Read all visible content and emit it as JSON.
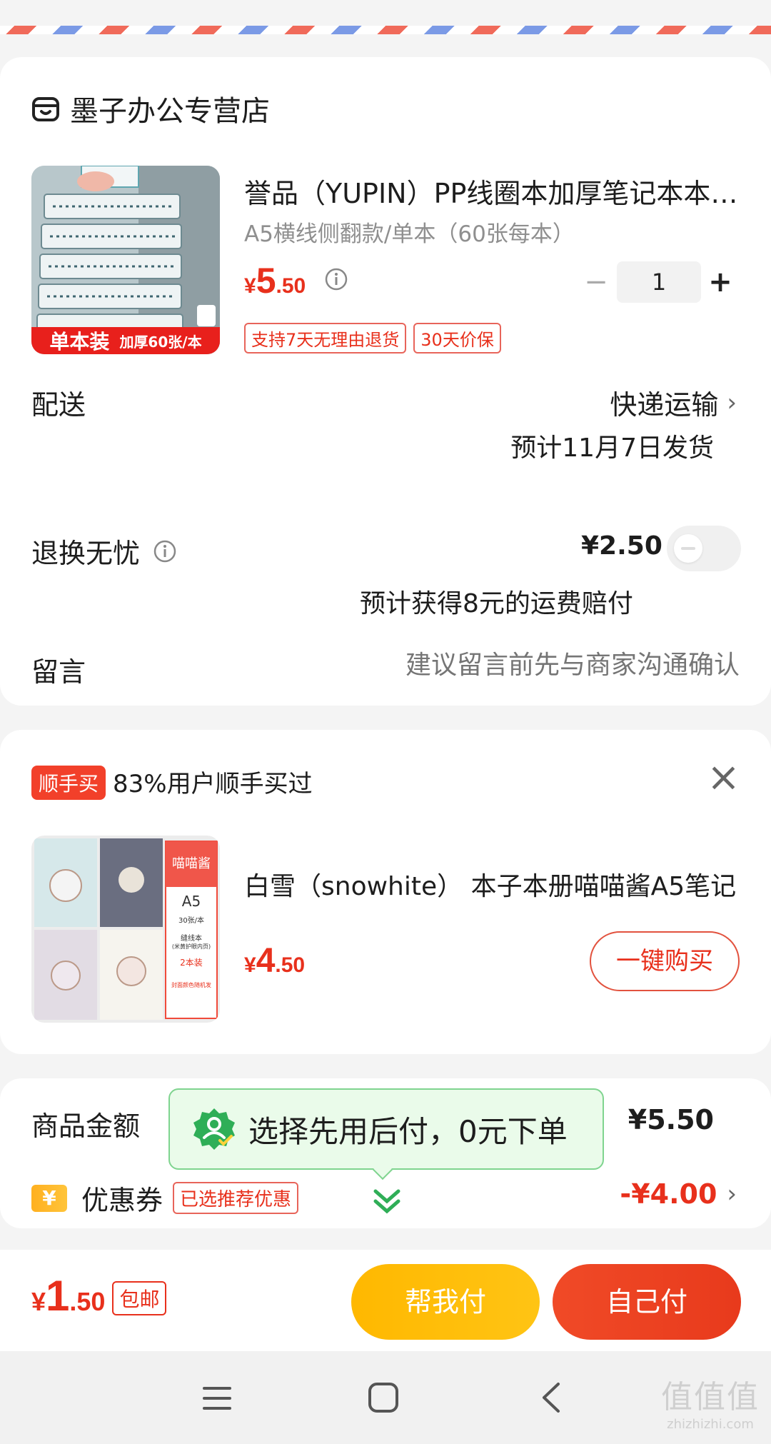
{
  "shop": {
    "name": "墨子办公专营店",
    "icon": "store-icon"
  },
  "product": {
    "title": "誉品（YUPIN）PP线圈本加厚笔记本本…",
    "spec": "A5横线侧翻款/单本（60张每本）",
    "price_symbol": "¥",
    "price_int": "5",
    "price_dec": ".50",
    "quantity": "1",
    "minus": "−",
    "plus": "+",
    "tags": [
      "支持7天无理由退货",
      "30天价保"
    ],
    "thumb_banner_main": "单本装",
    "thumb_banner_sub": "加厚60张/本"
  },
  "delivery": {
    "label": "配送",
    "method": "快递运输",
    "eta": "预计11月7日发货"
  },
  "return_service": {
    "label": "退换无忧",
    "price": "¥2.50",
    "note": "预计获得8元的运费赔付"
  },
  "message": {
    "label": "留言",
    "placeholder": "建议留言前先与商家沟通确认"
  },
  "addon": {
    "badge": "顺手买",
    "subtitle": "83%用户顺手买过",
    "close": "×",
    "title": "白雪（snowhite） 本子本册喵喵酱A5笔记…",
    "price_symbol": "¥",
    "price_int": "4",
    "price_dec": ".50",
    "buy_button": "一键购买",
    "thumb_title": "喵喵酱",
    "thumb_size": "A5",
    "thumb_line1": "30张/本",
    "thumb_line2": "缝线本",
    "thumb_line3": "(米黄护眼内页)",
    "thumb_line4": "2本装",
    "thumb_line5": "封面颜色随机发"
  },
  "summary": {
    "goods_label": "商品金额",
    "goods_amount": "¥5.50",
    "coupon_icon_text": "¥",
    "coupon_label": "优惠券",
    "coupon_tag": "已选推荐优惠",
    "coupon_amount": "-¥4.00",
    "popup_text": "选择先用后付，0元下单"
  },
  "footer": {
    "price_symbol": "¥",
    "price_int": "1",
    "price_dec": ".50",
    "shipping_tag": "包邮",
    "pay_for_me": "帮我付",
    "pay_self": "自己付"
  },
  "watermark": {
    "main": "值值值",
    "sub": "zhizhizhi.com"
  },
  "colors": {
    "accent": "#e8301c",
    "green": "#34b35a",
    "yellow": "#ffb800"
  }
}
